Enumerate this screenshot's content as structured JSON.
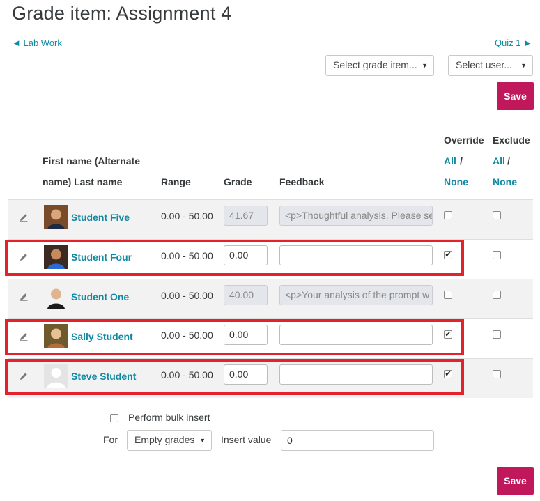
{
  "page": {
    "title": "Grade item: Assignment 4"
  },
  "nav": {
    "prev_label": "◄ Lab Work",
    "next_label": "Quiz 1 ►"
  },
  "filters": {
    "grade_item_select": "Select grade item...",
    "user_select": "Select user...",
    "caret": "▼"
  },
  "buttons": {
    "save_label": "Save"
  },
  "table": {
    "headers": {
      "name_line1": "First name (Alternate",
      "name_line2": "name) Last name",
      "range": "Range",
      "grade": "Grade",
      "feedback": "Feedback",
      "override": "Override",
      "exclude": "Exclude",
      "all": "All",
      "slash": "/",
      "none": "None"
    },
    "rows": [
      {
        "name": "Student Five",
        "range": "0.00 - 50.00",
        "grade": "41.67",
        "feedback": "<p>Thoughtful analysis. Please se",
        "override": false,
        "exclude": false,
        "disabled": true,
        "highlighted": false
      },
      {
        "name": "Student Four",
        "range": "0.00 - 50.00",
        "grade": "0.00",
        "feedback": "",
        "override": true,
        "exclude": false,
        "disabled": false,
        "highlighted": true
      },
      {
        "name": "Student One",
        "range": "0.00 - 50.00",
        "grade": "40.00",
        "feedback": "<p>Your analysis of the prompt w",
        "override": false,
        "exclude": false,
        "disabled": true,
        "highlighted": false
      },
      {
        "name": "Sally Student",
        "range": "0.00 - 50.00",
        "grade": "0.00",
        "feedback": "",
        "override": true,
        "exclude": false,
        "disabled": false,
        "highlighted": true
      },
      {
        "name": "Steve Student",
        "range": "0.00 - 50.00",
        "grade": "0.00",
        "feedback": "",
        "override": true,
        "exclude": false,
        "disabled": false,
        "highlighted": true
      }
    ]
  },
  "bulk": {
    "perform_label": "Perform bulk insert",
    "for_label": "For",
    "for_select": "Empty grades",
    "insert_label": "Insert value",
    "insert_value": "0"
  },
  "colors": {
    "accent": "#0f8aa3",
    "save": "#c1185b",
    "highlight": "#e5212b",
    "shaded_row": "#f2f2f2"
  },
  "icons": {
    "row_edit": "pencil-icon",
    "avatar": "avatar-icon",
    "checkmark": "✔"
  }
}
